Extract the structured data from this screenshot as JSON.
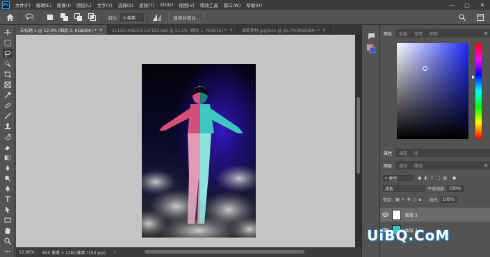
{
  "app": {
    "logo": "Ps"
  },
  "menu": [
    "文件(F)",
    "编辑(E)",
    "图像(I)",
    "图层(L)",
    "文字(Y)",
    "选择(S)",
    "滤镜(T)",
    "3D(D)",
    "视图(V)",
    "增效工具",
    "窗口(W)",
    "帮助(H)"
  ],
  "window_controls": {
    "minimize": "—",
    "maximize": "□",
    "close": "✕"
  },
  "options": {
    "feather_label": "羽化:",
    "feather_value": "0 像素",
    "select_subject": "选择并遮住..."
  },
  "tabs": [
    {
      "label": "未标题-1 @ 52.9% (图层 3, RGB/8#) *",
      "close": "×"
    },
    {
      "label": "31126140635016?150.psd @ 11.5% (图层 1, RGB/16) *",
      "close": "×"
    },
    {
      "label": "烟雾素材.jpg/icon @ 66.7%(RGB/8#) *",
      "close": "×"
    }
  ],
  "status": {
    "zoom": "52.86%",
    "info": "850 像素 x 1280 像素 (150 ppi)",
    "arrow": "›"
  },
  "panels": {
    "color_tabs": [
      "颜色",
      "色板",
      "渐变",
      "图案"
    ],
    "props_tabs": [
      "属性",
      "调整",
      "库"
    ],
    "layers_tabs": [
      "图层",
      "通道",
      "路径"
    ],
    "kind_label": "类型",
    "blend_mode": "滤色",
    "opacity_label": "不透明度:",
    "opacity_value": "100%",
    "lock_label": "锁定:",
    "fill_label": "填充:",
    "fill_value": "100%",
    "layers": [
      {
        "name": "图层 3",
        "selected": true
      },
      {
        "name": "图层 2",
        "selected": false
      }
    ]
  },
  "colors": {
    "foreground": "#3c56c8",
    "background": "#c88a98",
    "hue_color": "#1f2bff"
  },
  "watermark": "UiBQ.CoM"
}
